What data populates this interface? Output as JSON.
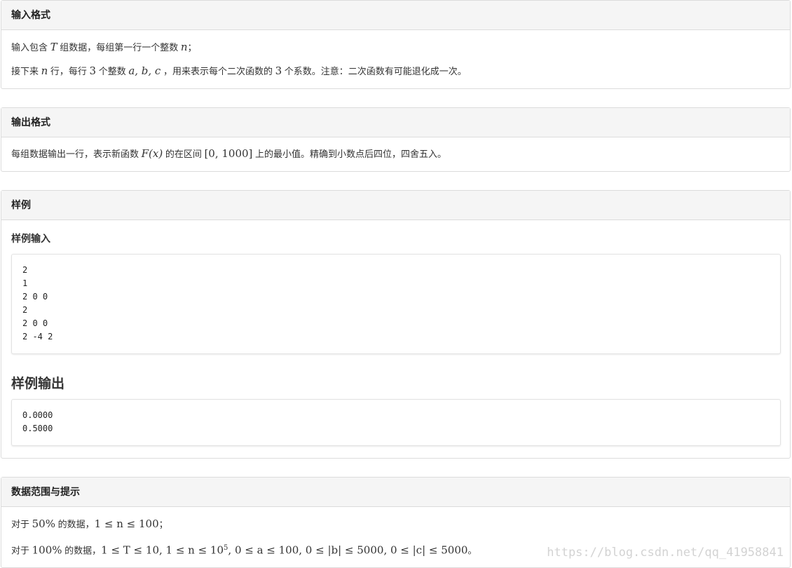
{
  "input_format": {
    "title": "输入格式",
    "line1": {
      "a": "输入包含 ",
      "var_T": "T",
      "b": " 组数据，每组第一行一个整数 ",
      "var_n": "n",
      "c": "；"
    },
    "line2": {
      "a": "接下来 ",
      "var_n": "n",
      "b": " 行，每行 ",
      "num_3": "3",
      "c": " 个整数 ",
      "vars": "a, b, c",
      "d": " ，用来表示每个二次函数的 ",
      "num_3b": "3",
      "e": " 个系数。注意：二次函数有可能退化成一次。"
    }
  },
  "output_format": {
    "title": "输出格式",
    "line1": {
      "a": "每组数据输出一行，表示新函数 ",
      "fx": "F(x)",
      "b": " 的在区间 ",
      "interval": "[0, 1000]",
      "c": " 上的最小值。精确到小数点后四位，四舍五入。"
    }
  },
  "sample": {
    "title": "样例",
    "input_title": "样例输入",
    "input_text": "2\n1\n2 0 0\n2\n2 0 0\n2 -4 2",
    "output_title": "样例输出",
    "output_text": "0.0000\n0.5000"
  },
  "hints": {
    "title": "数据范围与提示",
    "line1": {
      "a": "对于 ",
      "pct": "50%",
      "b": " 的数据，",
      "cond": "1 ≤ n ≤ 100",
      "c": "；"
    },
    "line2": {
      "a": "对于 ",
      "pct": "100%",
      "b": " 的数据，",
      "cond": "1 ≤ T ≤ 10, 1 ≤ n ≤ 10",
      "sup": "5",
      "cond2": ", 0 ≤ a ≤ 100, 0 ≤ |b| ≤ 5000, 0 ≤ |c| ≤ 5000",
      "c": "。"
    }
  },
  "watermark": "https://blog.csdn.net/qq_41958841"
}
